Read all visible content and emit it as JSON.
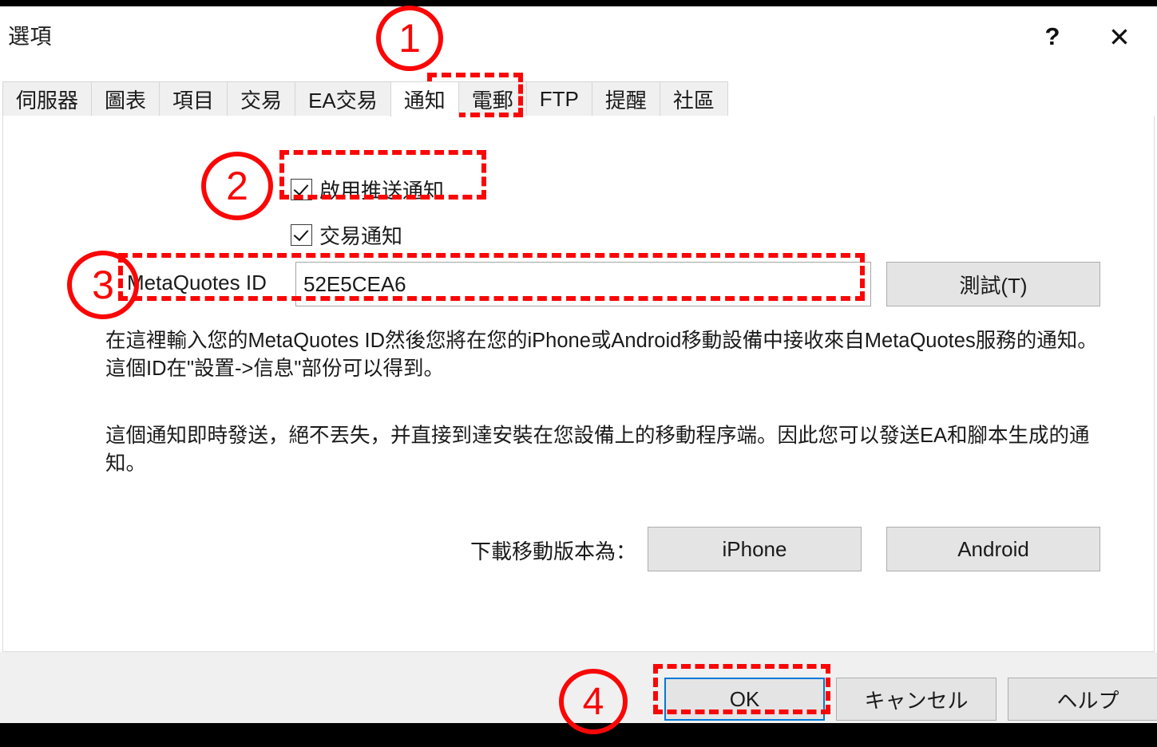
{
  "window": {
    "title": "選項",
    "help_icon_label": "?",
    "close_icon_label": "✕"
  },
  "tabs": [
    {
      "label": "伺服器",
      "selected": false
    },
    {
      "label": "圖表",
      "selected": false
    },
    {
      "label": "項目",
      "selected": false
    },
    {
      "label": "交易",
      "selected": false
    },
    {
      "label": "EA交易",
      "selected": false
    },
    {
      "label": "通知",
      "selected": true
    },
    {
      "label": "電郵",
      "selected": false
    },
    {
      "label": "FTP",
      "selected": false
    },
    {
      "label": "提醒",
      "selected": false
    },
    {
      "label": "社區",
      "selected": false
    }
  ],
  "notifications": {
    "enable_push": {
      "label": "啟用推送通知",
      "checked": true
    },
    "trade_notify": {
      "label": "交易通知",
      "checked": true
    },
    "metaquotes_id": {
      "label": "MetaQuotes ID",
      "value": "52E5CEA6",
      "placeholder": ""
    },
    "test_button": "測試(T)",
    "description_1": "在這裡輸入您的MetaQuotes ID然後您將在您的iPhone或Android移動設備中接收來自MetaQuotes服務的通知。這個ID在\"設置->信息\"部份可以得到。",
    "description_2": "這個通知即時發送，絕不丟失，并直接到達安裝在您設備上的移動程序端。因此您可以發送EA和腳本生成的通知。",
    "download_label": "下載移動版本為：",
    "download_iphone": "iPhone",
    "download_android": "Android"
  },
  "footer": {
    "ok": "OK",
    "cancel": "キャンセル",
    "help": "ヘルプ"
  },
  "annotations": {
    "numbers": [
      "1",
      "2",
      "3",
      "4"
    ],
    "accent_color": "#FB0606",
    "focus_color": "#0078D7"
  }
}
